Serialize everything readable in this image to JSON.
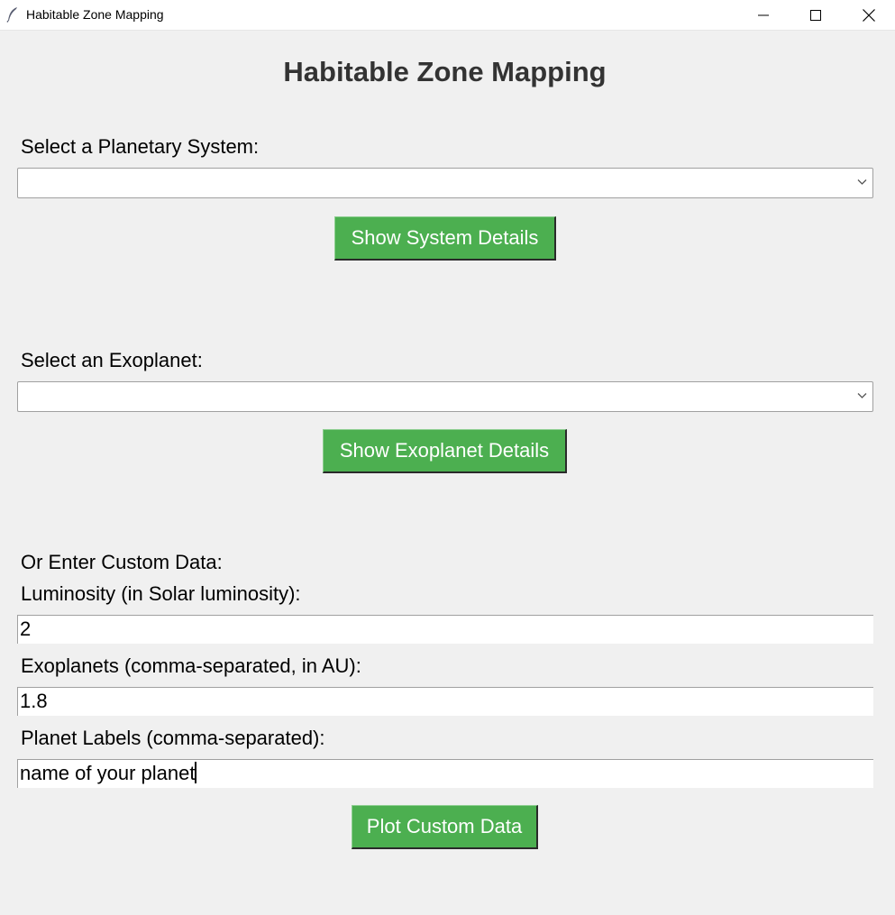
{
  "window": {
    "title": "Habitable Zone Mapping",
    "minimize_icon": "minimize-icon",
    "maximize_icon": "maximize-icon",
    "close_icon": "close-icon",
    "app_icon": "feather-icon"
  },
  "main": {
    "heading": "Habitable Zone Mapping",
    "system": {
      "label": "Select a Planetary System:",
      "selected_value": "",
      "button_label": "Show System Details"
    },
    "exoplanet": {
      "label": "Select an Exoplanet:",
      "selected_value": "",
      "button_label": "Show Exoplanet Details"
    },
    "custom": {
      "section_label": "Or Enter Custom Data:",
      "luminosity_label": "Luminosity (in Solar luminosity):",
      "luminosity_value": "2",
      "exoplanets_label": "Exoplanets (comma-separated, in AU):",
      "exoplanets_value": "1.8",
      "planet_labels_label": "Planet Labels (comma-separated):",
      "planet_labels_value": "name of your planet",
      "plot_button_label": "Plot Custom Data"
    }
  },
  "colors": {
    "accent_button": "#4caf50",
    "background": "#f0f0f0",
    "heading_text": "#333333"
  }
}
